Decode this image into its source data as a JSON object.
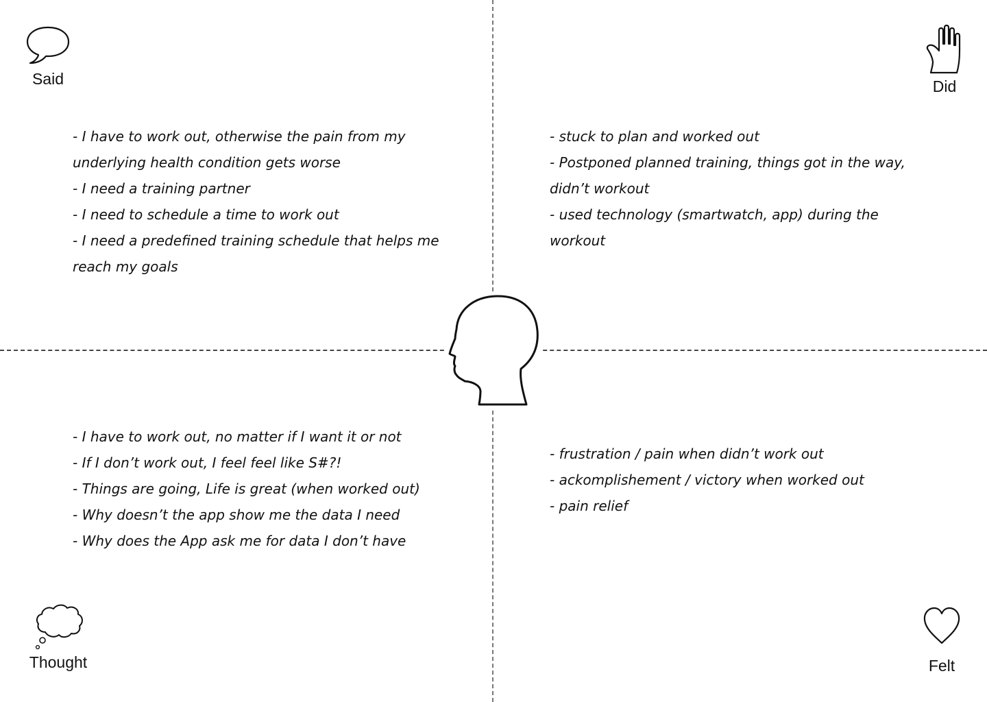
{
  "quadrants": {
    "said": {
      "label": "Said",
      "icon": "speech-bubble-icon",
      "items": [
        "I have to work out, otherwise the pain from my underlying health condition gets worse",
        "I need a training partner",
        "I need to schedule a time to work out",
        "I need a predefined training schedule that helps me reach my goals"
      ]
    },
    "did": {
      "label": "Did",
      "icon": "hand-icon",
      "items": [
        "stuck to plan and worked out",
        "Postponed planned training, things got in the way, didn’t workout",
        "used technology (smartwatch, app) during the workout"
      ]
    },
    "thought": {
      "label": "Thought",
      "icon": "thought-cloud-icon",
      "items": [
        "I have to work out, no matter if I want it or not",
        "If I don’t work out, I feel feel like S#?!",
        "Things are going, Life is great (when worked out)",
        "Why doesn’t the app show me the data I need",
        "Why does the App ask me for data I don’t have"
      ]
    },
    "felt": {
      "label": "Felt",
      "icon": "heart-icon",
      "items": [
        "frustration / pain when didn’t work out",
        "ackomplishement / victory when worked out",
        "pain relief"
      ]
    }
  },
  "center_icon": "head-profile-icon"
}
